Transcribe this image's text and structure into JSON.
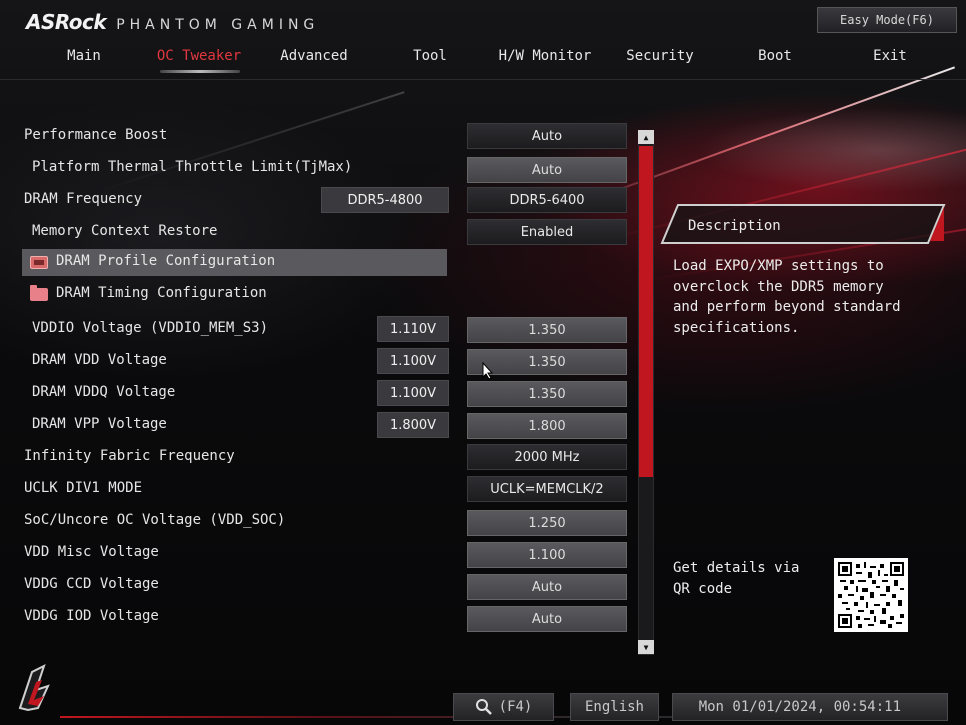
{
  "brand": {
    "logo": "ASRock",
    "subtitle": "PHANTOM GAMING"
  },
  "easy_mode_label": "Easy Mode(F6)",
  "tabs": [
    {
      "label": "Main"
    },
    {
      "label": "OC Tweaker",
      "active": true
    },
    {
      "label": "Advanced"
    },
    {
      "label": "Tool"
    },
    {
      "label": "H/W Monitor"
    },
    {
      "label": "Security"
    },
    {
      "label": "Boot"
    },
    {
      "label": "Exit"
    }
  ],
  "settings": {
    "performance_boost": {
      "label": "Performance Boost",
      "value": "Auto"
    },
    "thermal_throttle": {
      "label": "Platform Thermal Throttle Limit(TjMax)",
      "value": "Auto"
    },
    "dram_frequency": {
      "label": "DRAM Frequency",
      "current": "DDR5-4800",
      "value": "DDR5-6400"
    },
    "memory_context_restore": {
      "label": "Memory Context Restore",
      "value": "Enabled"
    },
    "dram_profile_config": {
      "label": "DRAM Profile Configuration"
    },
    "dram_timing_config": {
      "label": "DRAM Timing Configuration"
    },
    "vddio_voltage": {
      "label": "VDDIO Voltage (VDDIO_MEM_S3)",
      "current": "1.110V",
      "value": "1.350"
    },
    "dram_vdd_voltage": {
      "label": "DRAM VDD Voltage",
      "current": "1.100V",
      "value": "1.350"
    },
    "dram_vddq_voltage": {
      "label": "DRAM VDDQ Voltage",
      "current": "1.100V",
      "value": "1.350"
    },
    "dram_vpp_voltage": {
      "label": "DRAM VPP Voltage",
      "current": "1.800V",
      "value": "1.800"
    },
    "infinity_fabric_freq": {
      "label": "Infinity Fabric Frequency",
      "value": "2000 MHz"
    },
    "uclk_div1_mode": {
      "label": "UCLK DIV1 MODE",
      "value": "UCLK=MEMCLK/2"
    },
    "soc_uncore_voltage": {
      "label": "SoC/Uncore OC Voltage (VDD_SOC)",
      "value": "1.250"
    },
    "vdd_misc_voltage": {
      "label": "VDD Misc Voltage",
      "value": "1.100"
    },
    "vddg_ccd_voltage": {
      "label": "VDDG CCD Voltage",
      "value": "Auto"
    },
    "vddg_iod_voltage": {
      "label": "VDDG IOD Voltage",
      "value": "Auto"
    }
  },
  "description": {
    "title": "Description",
    "text": "Load EXPO/XMP settings to overclock the DDR5 memory and perform beyond standard specifications."
  },
  "qr": {
    "text": "Get details via QR code"
  },
  "footer": {
    "search_key": "(F4)",
    "language": "English",
    "datetime": "Mon 01/01/2024, 00:54:11"
  },
  "colors": {
    "accent": "#c0161f",
    "active_tab": "#e2373f",
    "panel": "#3a3a3e"
  }
}
